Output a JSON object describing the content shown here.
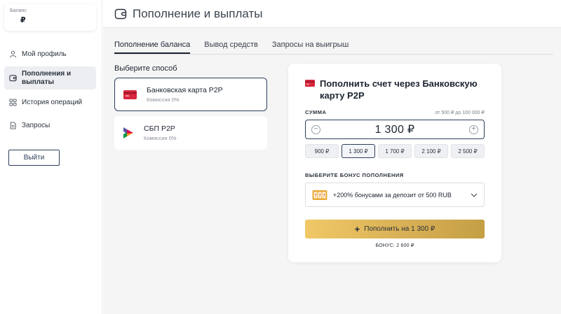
{
  "sidebar": {
    "balance_label": "Баланс",
    "balance_value": "₽",
    "items": [
      {
        "label": "Мой профиль",
        "icon": "user-icon"
      },
      {
        "label": "Пополнения и выплаты",
        "icon": "wallet-icon"
      },
      {
        "label": "История операций",
        "icon": "grid-icon"
      },
      {
        "label": "Запросы",
        "icon": "document-icon"
      }
    ],
    "logout_label": "Выйти"
  },
  "header": {
    "title": "Пополнение и выплаты",
    "icon": "wallet-icon"
  },
  "tabs": [
    {
      "label": "Пополнение баланса",
      "active": true
    },
    {
      "label": "Вывод средств",
      "active": false
    },
    {
      "label": "Запросы на выигрыш",
      "active": false
    }
  ],
  "methods": {
    "heading": "Выберите способ",
    "items": [
      {
        "title": "Банковская карта P2P",
        "subtitle": "Комиссия 0%",
        "icon": "card-icon",
        "selected": true
      },
      {
        "title": "СБП P2P",
        "subtitle": "Комиссия 0%",
        "icon": "sbp-icon",
        "selected": false
      }
    ]
  },
  "panel": {
    "title_line1": "Пополнить счет через Банковскую",
    "title_line2": "карту P2P",
    "sum_label": "СУММА",
    "sum_range": "от 500 ₽ до 100 000 ₽",
    "amount": "1 300 ₽",
    "presets": [
      "900 ₽",
      "1 300 ₽",
      "1 700 ₽",
      "2 100 ₽",
      "2 500 ₽"
    ],
    "selected_preset": 1,
    "bonus_label": "ВЫБЕРИТЕ БОНУС ПОПОЛНЕНИЯ",
    "bonus_option": "+200% бонусами за депозит от 500 RUB",
    "deposit_button": "Пополнить на 1 300 ₽",
    "bonus_total": "БОНУС: 2 600 ₽"
  },
  "colors": {
    "accent_dark": "#2d3f5a",
    "gold": "#d9b056",
    "card_red": "#d7263d"
  }
}
